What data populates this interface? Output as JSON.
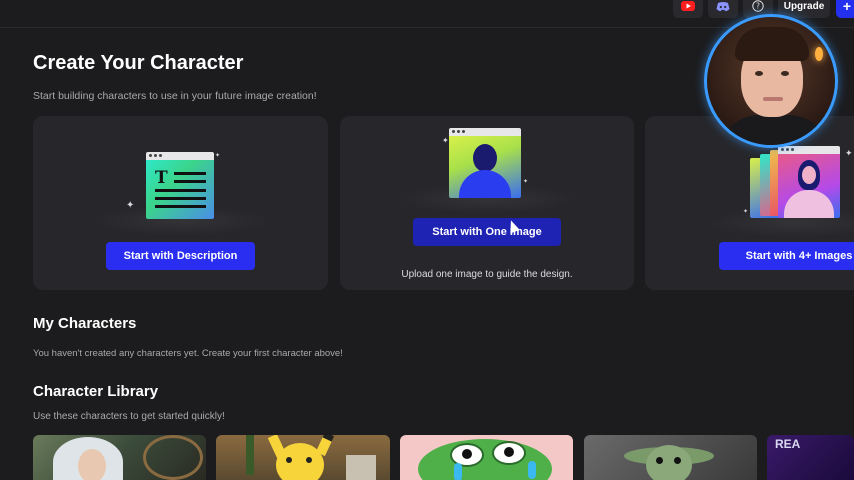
{
  "topbar": {
    "youtube_icon": "youtube-icon",
    "discord_icon": "discord-icon",
    "help_icon": "help-icon",
    "help_glyph": "?",
    "upgrade_label": "Upgrade",
    "plus_label": "+"
  },
  "header": {
    "title": "Create Your Character",
    "subtitle": "Start building characters to use in your future image creation!"
  },
  "cards": [
    {
      "button": "Start with Description",
      "note": ""
    },
    {
      "button": "Start with One Image",
      "note": "Upload one image to guide the design."
    },
    {
      "button": "Start with 4+ Images",
      "note": ""
    }
  ],
  "doc_icon": {
    "letter": "T"
  },
  "my_characters": {
    "title": "My Characters",
    "empty_text": "You haven't created any characters yet. Create your first character above!"
  },
  "library": {
    "title": "Character Library",
    "subtitle": "Use these characters to get started quickly!",
    "fifth_tile_text": "REA"
  },
  "colors": {
    "accent": "#2a2ef0",
    "background": "#1c1c1e",
    "card": "#27272b",
    "avatar_ring": "#3a9bff"
  }
}
